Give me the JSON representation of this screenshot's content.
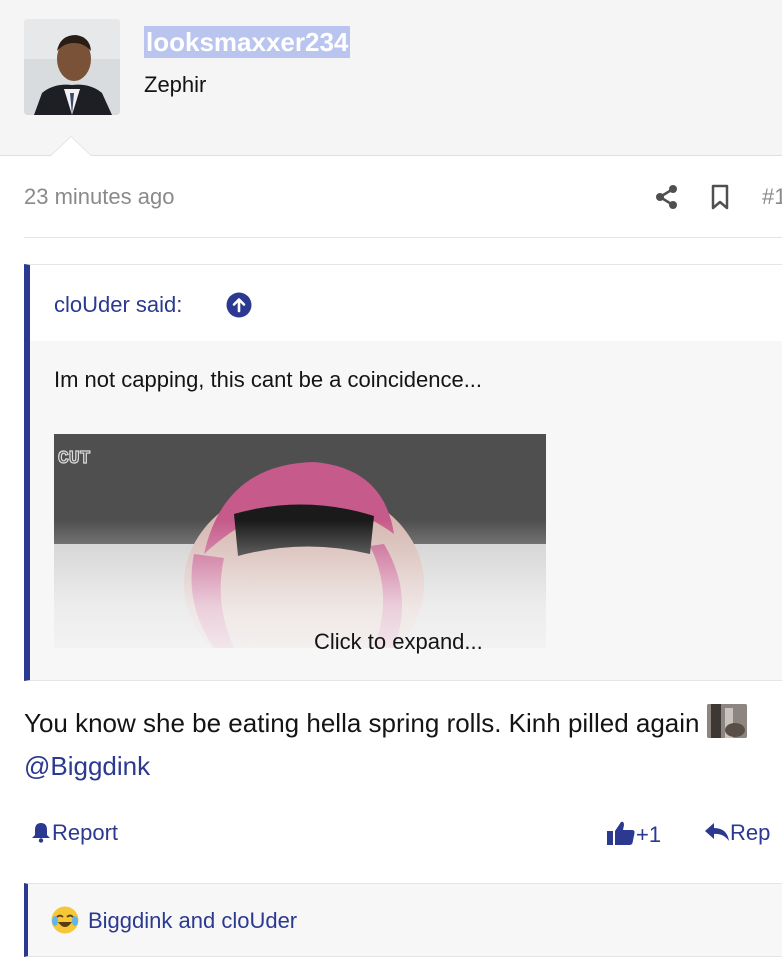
{
  "post": {
    "username": "looksmaxxer234",
    "user_title": "Zephir",
    "timestamp": "23 minutes ago",
    "post_number": "#1",
    "quote": {
      "author_line": "cloUder said:",
      "text": "Im not capping, this cant be a coincidence...",
      "image_caption": "CUT",
      "expand_label": "Click to expand..."
    },
    "message_text": "You know she be eating hella spring rolls. Kinh pilled again",
    "mention": "@Biggdink",
    "actions": {
      "report_label": "Report",
      "like_label": "+1",
      "reply_label": "Rep"
    },
    "reactions": {
      "text": "Biggdink and cloUder",
      "emoji": "crying-laughing-emoji"
    }
  },
  "colors": {
    "accent": "#2b3990",
    "username_highlight": "#b9c4ef",
    "header_bg": "#f5f5f5",
    "quote_bg": "#f7f7f7"
  }
}
